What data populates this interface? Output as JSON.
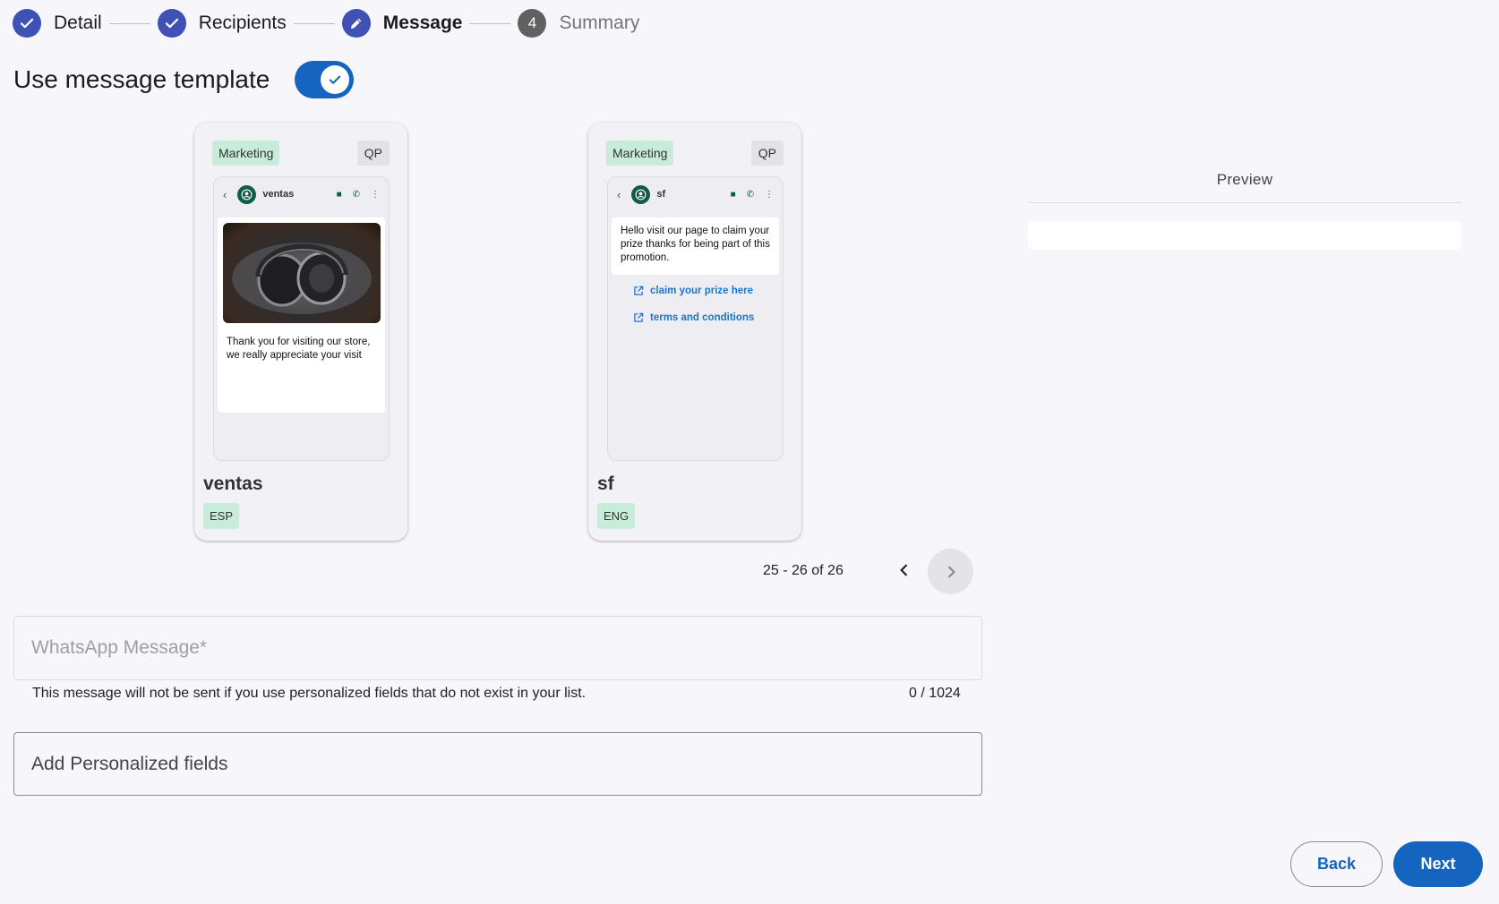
{
  "stepper": {
    "steps": [
      {
        "label": "Detail",
        "state": "done",
        "icon": "check-icon"
      },
      {
        "label": "Recipients",
        "state": "done",
        "icon": "check-icon"
      },
      {
        "label": "Message",
        "state": "active",
        "icon": "pencil-icon"
      },
      {
        "label": "Summary",
        "state": "todo",
        "number": "4"
      }
    ]
  },
  "template_toggle": {
    "label": "Use message template",
    "enabled": true
  },
  "templates": [
    {
      "category": "Marketing",
      "badge": "QP",
      "contact": "ventas",
      "has_image": true,
      "image_icon": "headphones-photo",
      "body": "Thank you for visiting our store, we really appreciate your visit",
      "links": [],
      "name": "ventas",
      "language": "ESP"
    },
    {
      "category": "Marketing",
      "badge": "QP",
      "contact": "sf",
      "has_image": false,
      "body": "Hello visit our page to claim your prize thanks for being part of this promotion.",
      "links": [
        "claim your prize here",
        "terms and conditions"
      ],
      "name": "sf",
      "language": "ENG"
    }
  ],
  "pagination": {
    "range": "25 - 26 of 26"
  },
  "preview": {
    "title": "Preview"
  },
  "message_field": {
    "placeholder": "WhatsApp Message*",
    "hint": "This message will not be sent if you use personalized fields that do not exist in your list.",
    "counter": "0 / 1024"
  },
  "personalized_field": {
    "placeholder": "Add Personalized fields"
  },
  "buttons": {
    "back": "Back",
    "next": "Next"
  },
  "colors": {
    "primary": "#1565c0",
    "step_done": "#3f51b5",
    "chip_green": "#c7ecd9",
    "whatsapp_green": "#0f5c4a"
  }
}
